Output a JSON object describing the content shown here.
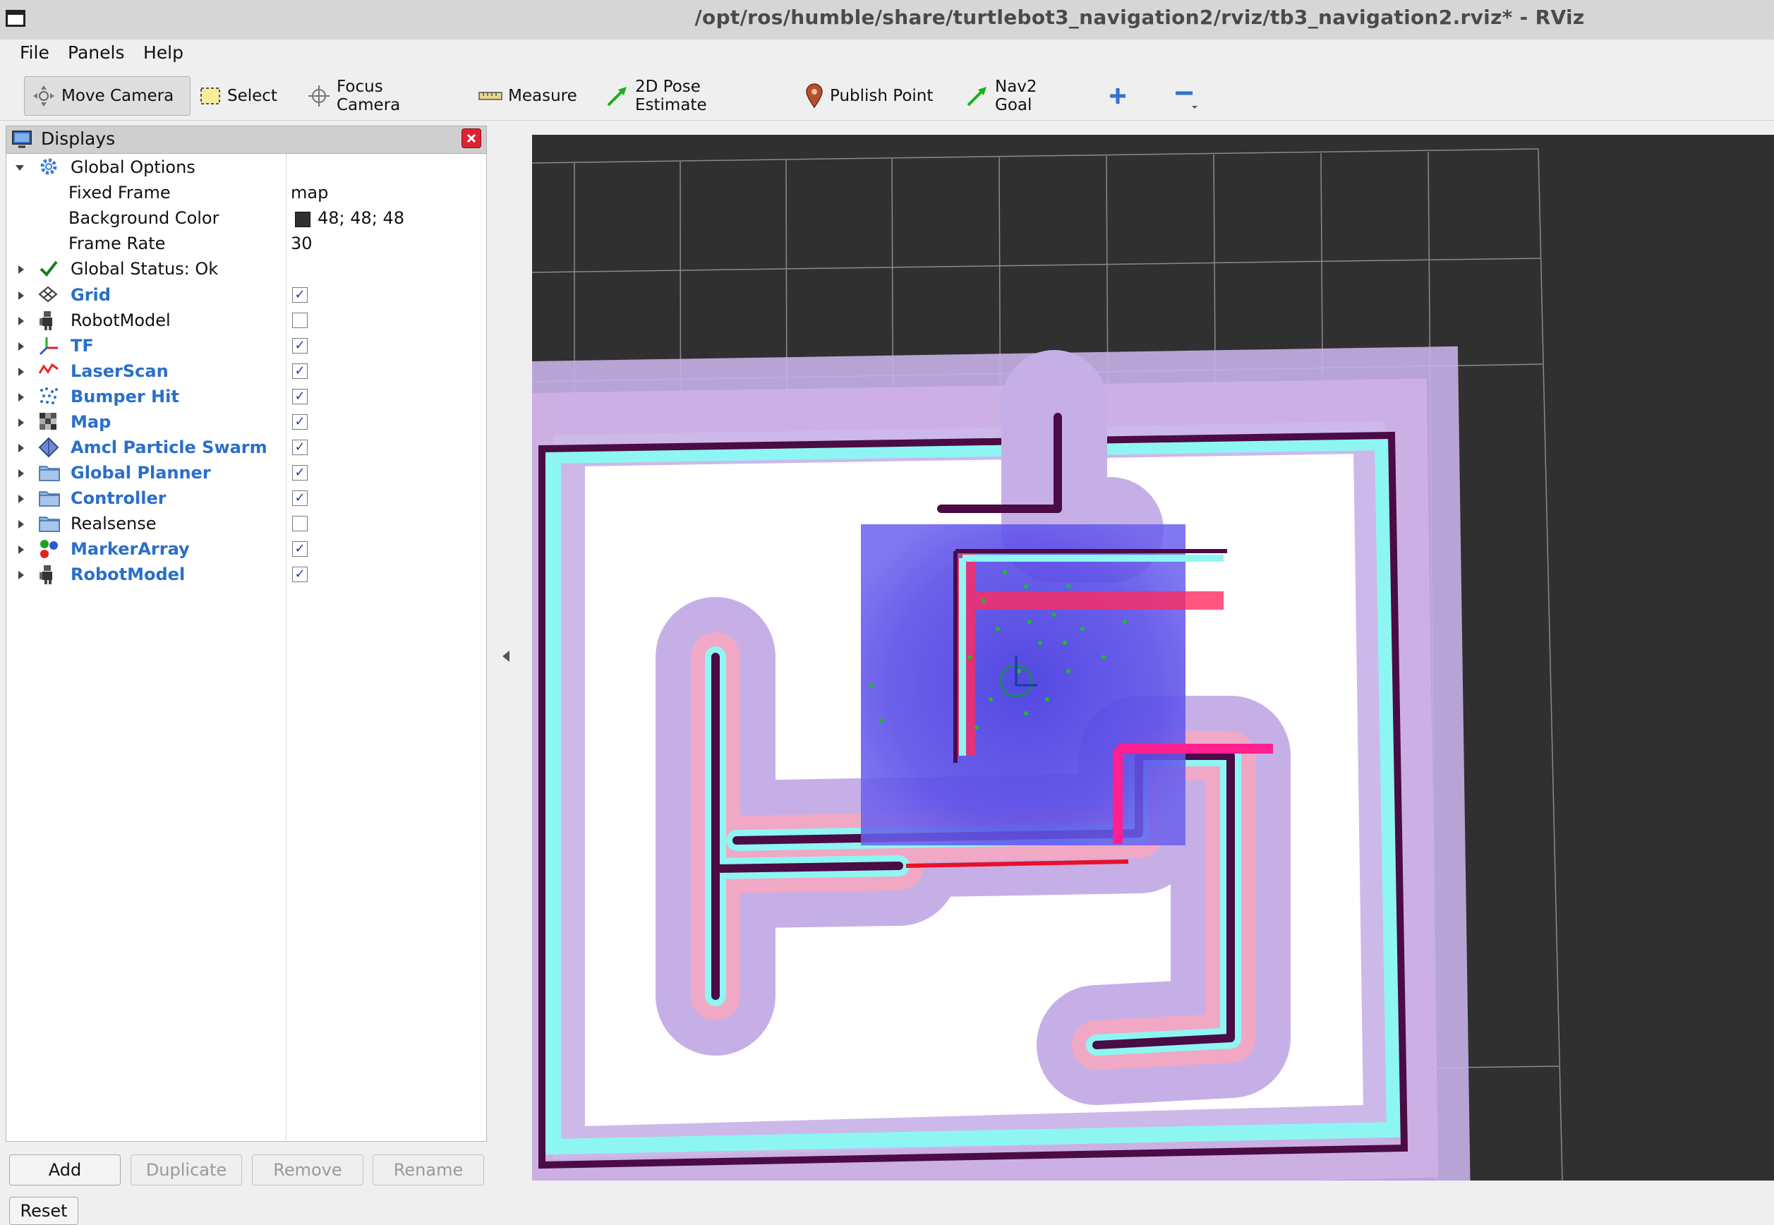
{
  "window": {
    "title": "/opt/ros/humble/share/turtlebot3_navigation2/rviz/tb3_navigation2.rviz* - RViz"
  },
  "menu": {
    "file": "File",
    "panels": "Panels",
    "help": "Help"
  },
  "toolbar": {
    "move_camera": "Move Camera",
    "select": "Select",
    "focus_camera": "Focus Camera",
    "measure": "Measure",
    "pose_estimate": "2D Pose Estimate",
    "publish_point": "Publish Point",
    "nav2_goal": "Nav2 Goal"
  },
  "displays": {
    "title": "Displays",
    "global_options": "Global Options",
    "fixed_frame": {
      "label": "Fixed Frame",
      "value": "map"
    },
    "background_color": {
      "label": "Background Color",
      "value": "48; 48; 48",
      "swatch": "#303030"
    },
    "frame_rate": {
      "label": "Frame Rate",
      "value": "30"
    },
    "global_status": "Global Status: Ok",
    "items": [
      {
        "label": "Grid",
        "checked": true,
        "icon": "grid-icon"
      },
      {
        "label": "RobotModel",
        "checked": false,
        "icon": "robot-icon"
      },
      {
        "label": "TF",
        "checked": true,
        "icon": "tf-axes-icon"
      },
      {
        "label": "LaserScan",
        "checked": true,
        "icon": "laserscan-icon"
      },
      {
        "label": "Bumper Hit",
        "checked": true,
        "icon": "pointcloud-icon"
      },
      {
        "label": "Map",
        "checked": true,
        "icon": "map-icon"
      },
      {
        "label": "Amcl Particle Swarm",
        "checked": true,
        "icon": "pose-array-icon"
      },
      {
        "label": "Global Planner",
        "checked": true,
        "icon": "folder-icon"
      },
      {
        "label": "Controller",
        "checked": true,
        "icon": "folder-icon"
      },
      {
        "label": "Realsense",
        "checked": false,
        "icon": "folder-icon"
      },
      {
        "label": "MarkerArray",
        "checked": true,
        "icon": "marker-array-icon"
      },
      {
        "label": "RobotModel",
        "checked": true,
        "icon": "robot-icon"
      }
    ]
  },
  "buttons": {
    "add": "Add",
    "duplicate": "Duplicate",
    "remove": "Remove",
    "rename": "Rename",
    "reset": "Reset"
  },
  "colors": {
    "viewport_bg": "#303030",
    "accent": "#2a6fc9",
    "costmap_inflation": "#c7aee6",
    "costmap_pink": "#f2a7c3",
    "costmap_cyan": "#88f6f2",
    "wall": "#4b0b45",
    "local_costmap": "#5a50e6",
    "particles": "#19c019"
  }
}
